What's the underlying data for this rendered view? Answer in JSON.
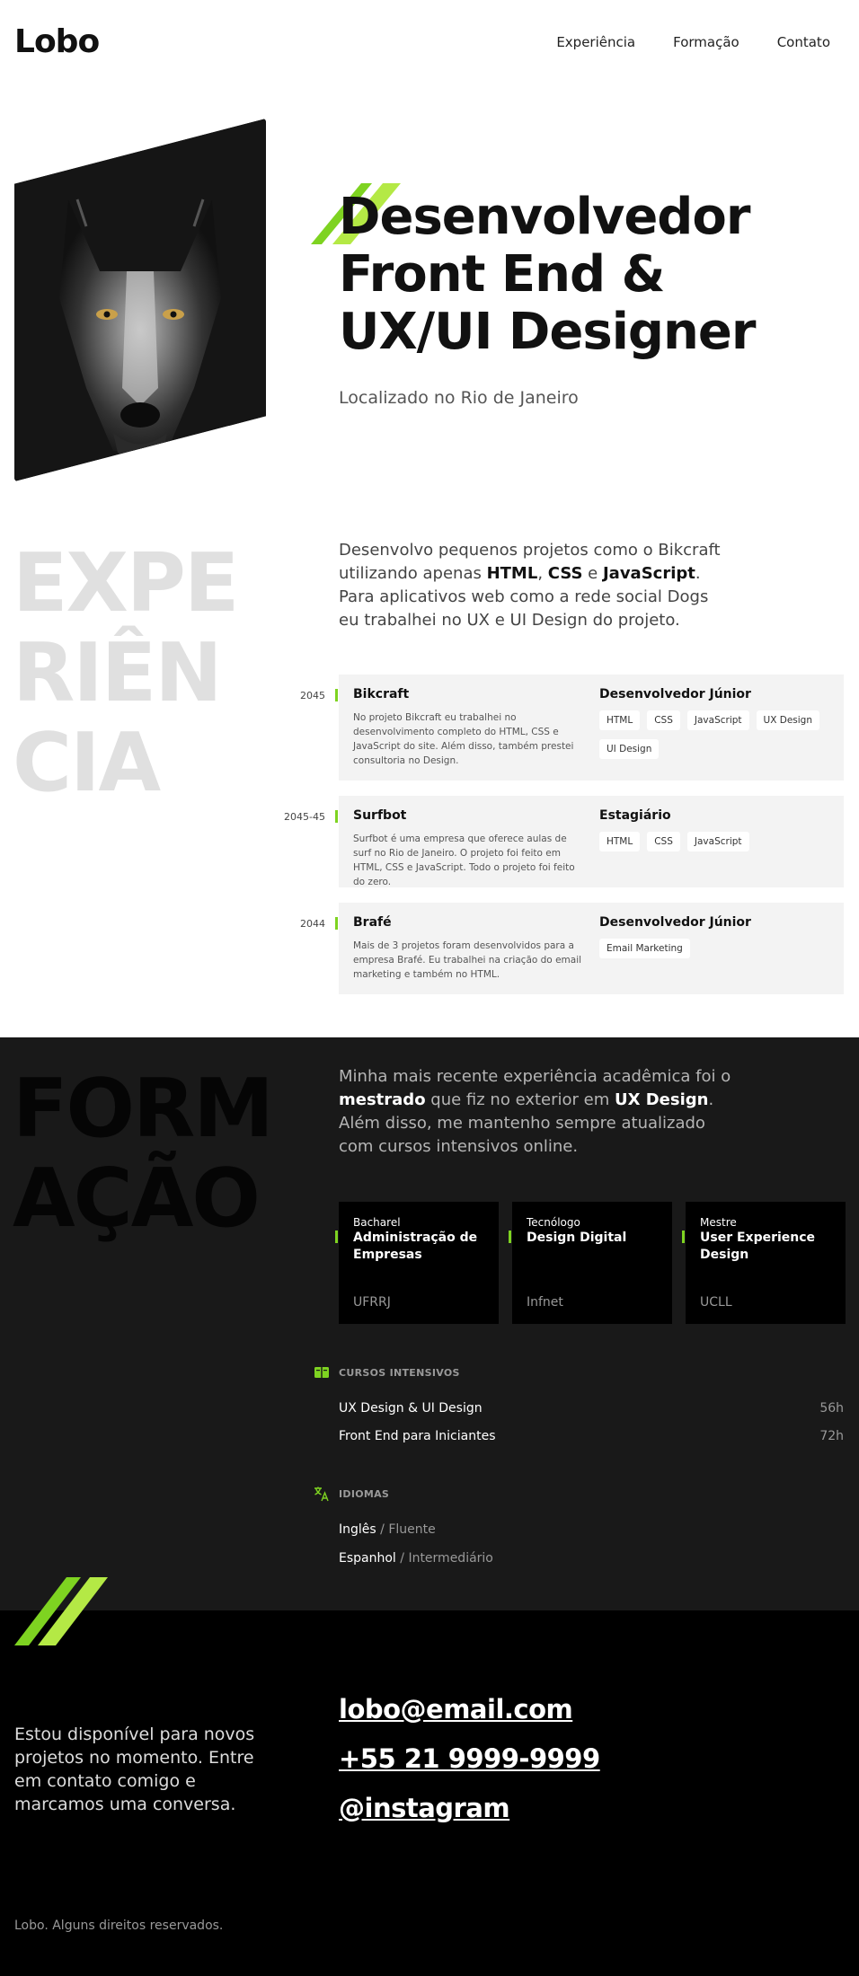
{
  "header": {
    "logo": "Lobo",
    "nav": [
      "Experiência",
      "Formação",
      "Contato"
    ]
  },
  "hero": {
    "image_alt": "wolf-photo",
    "title_lines": [
      "Desenvolvedor",
      "Front End &",
      "UX/UI Designer"
    ],
    "subtitle": "Localizado no Rio de Janeiro"
  },
  "experience": {
    "big_lines": [
      "EXPE",
      "RIÊN",
      "CIA"
    ],
    "intro": {
      "p1": "Desenvolvo pequenos projetos como o Bikcraft utilizando apenas ",
      "b1": "HTML",
      "p2": ", ",
      "b2": "CSS",
      "p3": " e ",
      "b3": "JavaScript",
      "p4": ". Para aplicativos web como a rede social Dogs eu trabalhei no UX e UI Design do projeto."
    },
    "items": [
      {
        "year": "2045",
        "company": "Bikcraft",
        "description": "No projeto Bikcraft eu trabalhei no desenvolvimento completo do HTML, CSS e JavaScript do site. Além disso, também prestei consultoria no Design.",
        "role": "Desenvolvedor Júnior",
        "tags": [
          "HTML",
          "CSS",
          "JavaScript",
          "UX Design",
          "UI Design"
        ]
      },
      {
        "year": "2045-45",
        "company": "Surfbot",
        "description": "Surfbot é uma empresa que oferece aulas de surf no Rio de Janeiro. O projeto foi feito em HTML, CSS e JavaScript. Todo o projeto foi feito do zero.",
        "role": "Estagiário",
        "tags": [
          "HTML",
          "CSS",
          "JavaScript"
        ]
      },
      {
        "year": "2044",
        "company": "Brafé",
        "description": "Mais de 3 projetos foram desenvolvidos para a empresa Brafé. Eu trabalhei na criação do email marketing e também no HTML.",
        "role": "Desenvolvedor Júnior",
        "tags": [
          "Email Marketing"
        ]
      }
    ]
  },
  "education": {
    "big_lines": [
      "FORM",
      "AÇÃO"
    ],
    "intro": {
      "p1": "Minha mais recente experiência acadêmica foi o ",
      "b1": "mestrado",
      "p2": " que fiz no exterior em ",
      "b2": "UX Design",
      "p3": ". Além disso, me mantenho sempre atualizado com cursos intensivos online."
    },
    "cards": [
      {
        "type": "Bacharel",
        "name": "Administração de Empresas",
        "institution": "UFRRJ"
      },
      {
        "type": "Tecnólogo",
        "name": "Design Digital",
        "institution": "Infnet"
      },
      {
        "type": "Mestre",
        "name": "User Experience Design",
        "institution": "UCLL"
      }
    ],
    "courses_title": "CURSOS INTENSIVOS",
    "courses": [
      {
        "name": "UX Design & UI Design",
        "hours": "56h"
      },
      {
        "name": "Front End para Iniciantes",
        "hours": "72h"
      }
    ],
    "languages_title": "IDIOMAS",
    "languages": [
      {
        "name": "Inglês",
        "sep": " / ",
        "level": "Fluente"
      },
      {
        "name": "Espanhol",
        "sep": " / ",
        "level": "Intermediário"
      }
    ]
  },
  "contact": {
    "text": "Estou disponível para novos projetos no momento. Entre em contato comigo e marcamos uma conversa.",
    "email": "lobo@email.com",
    "phone": "+55 21 9999-9999",
    "instagram": "@instagram"
  },
  "footer": {
    "copyright": "Lobo. Alguns direitos reservados."
  },
  "colors": {
    "accent": "#7ed321",
    "accent_light": "#b4e945",
    "dark_section": "#191919",
    "footer_bg": "#000000"
  }
}
